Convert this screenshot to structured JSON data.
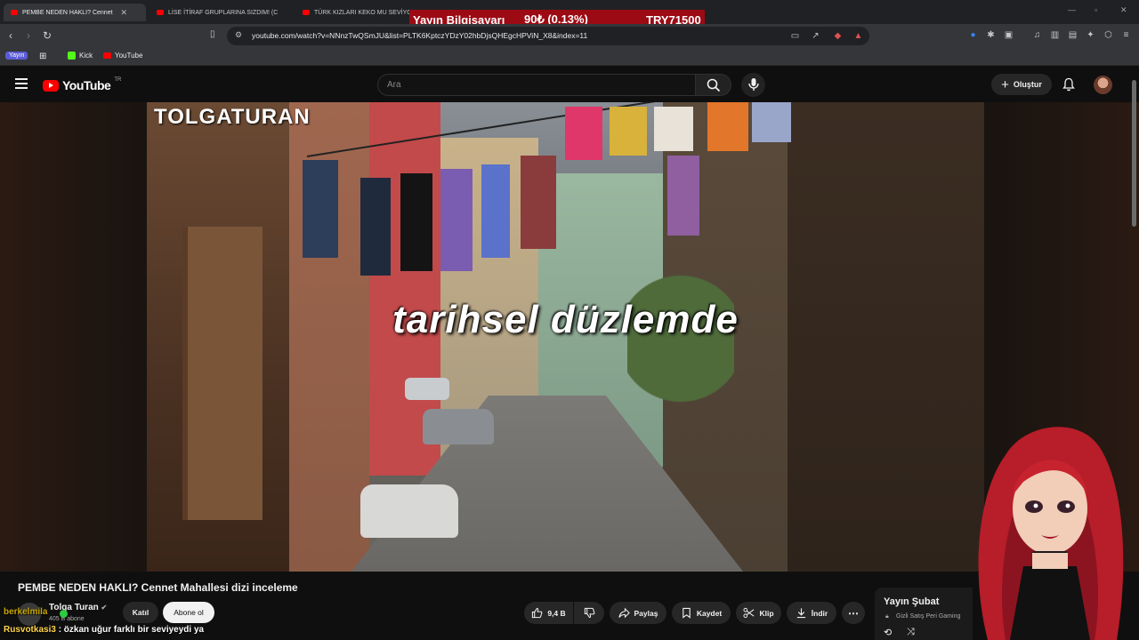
{
  "browser": {
    "tabs": [
      {
        "label": "PEMBE NEDEN HAKLI? Cennet",
        "active": true
      },
      {
        "label": "LİSE İTİRAF GRUPLARINA SIZDIM! (C",
        "active": false
      },
      {
        "label": "TÜRK KIZLARI KEKO MU SEVİYOR?",
        "active": false
      }
    ],
    "url": "youtube.com/watch?v=NNnzTwQSmJU&list=PLTK6KptczYDzY02hbDjsQHEgcHPViN_X8&index=11",
    "bookmarks": [
      {
        "label": "Yayın",
        "icon": "yayin-badge"
      },
      {
        "label": "Kick",
        "icon": "kick-icon"
      },
      {
        "label": "YouTube",
        "icon": "youtube-icon"
      }
    ]
  },
  "donation_banner": {
    "name": "Yayın Bilgisayarı",
    "change": "90₺ (0.13%)",
    "total": "TRY71500",
    "color": "#9c0a14"
  },
  "youtube": {
    "region": "TR",
    "logo_text": "YouTube",
    "search_placeholder": "Ara",
    "create_label": "Oluştur",
    "video": {
      "watermark": "TOLGATURAN",
      "caption": "tarihsel düzlemde"
    },
    "title": "PEMBE NEDEN HAKLI? Cennet Mahallesi dizi inceleme",
    "channel": {
      "name": "Tolga Turan",
      "subscribers": "405 B abone",
      "join_label": "Katıl",
      "subscribe_label": "Abone ol"
    },
    "actions": {
      "likes": "9,4 B",
      "share": "Paylaş",
      "save": "Kaydet",
      "clip": "Klip",
      "download": "İndir"
    },
    "side_panel": {
      "title": "Yayın Şubat",
      "subtitle": "Gizli Satış Peri Gaming"
    }
  },
  "stream_chat": [
    {
      "user": "berkelmila",
      "message": ""
    },
    {
      "user": "Rusvotkasi3",
      "message": ": özkan uğur farklı bir seviyeydi ya"
    }
  ],
  "colors": {
    "youtube_red": "#ff0000",
    "background": "#0f0f0f",
    "accent_purple": "#5b5bd6"
  }
}
